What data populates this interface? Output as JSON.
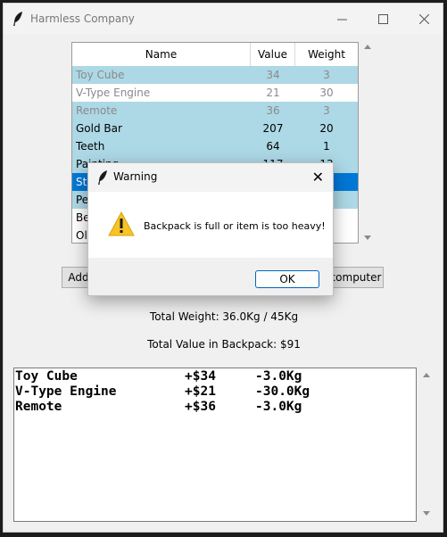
{
  "window": {
    "title": "Harmless Company",
    "minimize": "—",
    "maximize": "☐",
    "close": "✕"
  },
  "tree": {
    "columns": [
      "Name",
      "Value",
      "Weight"
    ],
    "rows": [
      {
        "name": "Toy Cube",
        "value": "34",
        "weight": "3",
        "style": "blue disabled"
      },
      {
        "name": "V-Type Engine",
        "value": "21",
        "weight": "30",
        "style": "white disabled"
      },
      {
        "name": "Remote",
        "value": "36",
        "weight": "3",
        "style": "blue disabled"
      },
      {
        "name": "Gold Bar",
        "value": "207",
        "weight": "20",
        "style": "blue"
      },
      {
        "name": "Teeth",
        "value": "64",
        "weight": "1",
        "style": "blue"
      },
      {
        "name": "Painting",
        "value": "117",
        "weight": "13",
        "style": "blue"
      },
      {
        "name": "Sto",
        "value": "",
        "weight": "",
        "style": "sel"
      },
      {
        "name": "Pe",
        "value": "",
        "weight": "",
        "style": "blue"
      },
      {
        "name": "Be",
        "value": "",
        "weight": "",
        "style": "white"
      },
      {
        "name": "Ol",
        "value": "",
        "weight": "",
        "style": "white"
      }
    ]
  },
  "buttons": {
    "add_label": "Add",
    "computer_label": "computer"
  },
  "summary": {
    "total_weight": "Total Weight: 36.0Kg / 45Kg",
    "total_value": "Total Value in Backpack: $91"
  },
  "backpack_log": [
    {
      "item": "Toy Cube",
      "value": "+$34",
      "weight": "-3.0Kg"
    },
    {
      "item": "V-Type Engine",
      "value": "+$21",
      "weight": "-30.0Kg"
    },
    {
      "item": "Remote",
      "value": "+$36",
      "weight": "-3.0Kg"
    }
  ],
  "dialog": {
    "title": "Warning",
    "message": "Backpack is full or item is too heavy!",
    "ok_label": "OK",
    "close": "✕"
  },
  "colors": {
    "row_highlight": "#add8e6",
    "row_selected": "#0078d7",
    "ok_border": "#0067c0",
    "warning_icon": "#f7c325"
  }
}
